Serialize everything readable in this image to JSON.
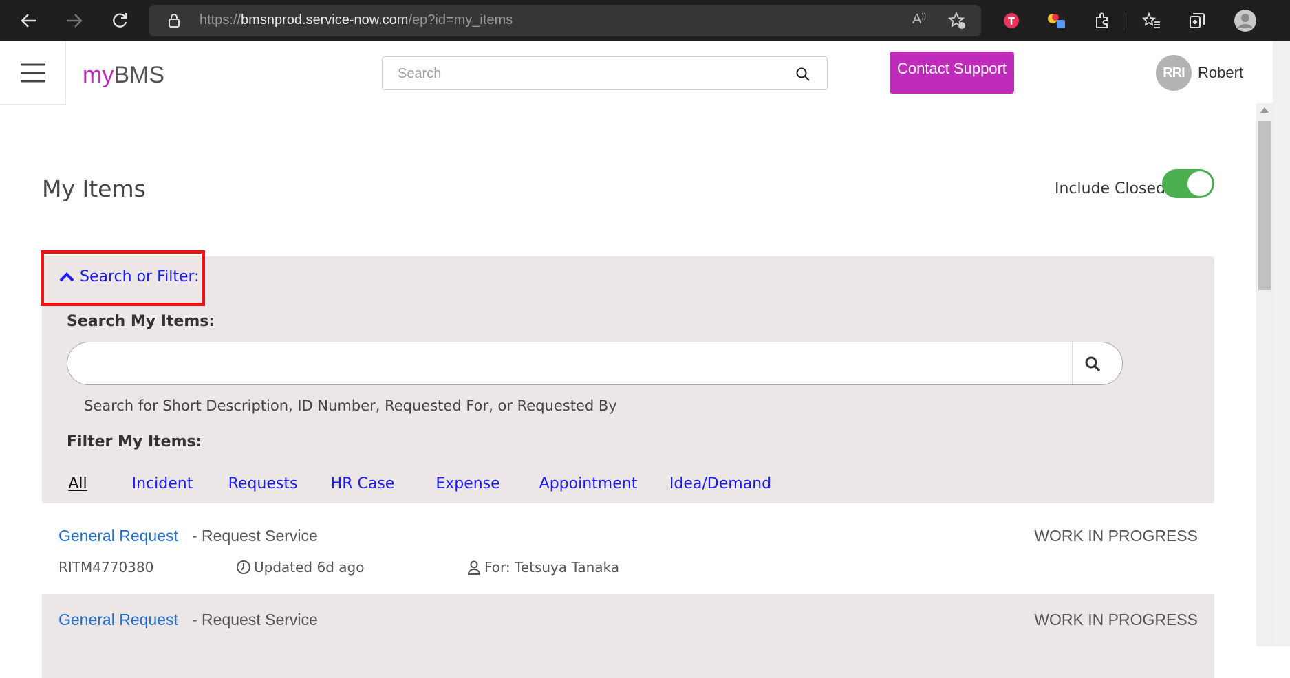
{
  "browser": {
    "url_prefix": "https://",
    "url_host": "bmsnprod.service-now.com",
    "url_path": "/ep?id=my_items"
  },
  "header": {
    "logo_my": "my",
    "logo_rest": "BMS",
    "search_placeholder": "Search",
    "contact_label": "Contact Support",
    "avatar_initials": "RRI",
    "user_name": "Robert"
  },
  "page": {
    "title": "My Items",
    "include_closed_label": "Include Closed",
    "include_closed_on": true
  },
  "filter": {
    "toggle_label": "Search or Filter:",
    "search_label": "Search My Items:",
    "search_value": "",
    "help_text": "Search for Short Description, ID Number, Requested For, or Requested By",
    "filter_label": "Filter My Items:",
    "tabs": [
      "All",
      "Incident",
      "Requests",
      "HR Case",
      "Expense",
      "Appointment",
      "Idea/Demand"
    ],
    "active_tab": "All"
  },
  "items": [
    {
      "link": "General Request",
      "type": "- Request Service",
      "status": "WORK IN PROGRESS",
      "number": "RITM4770380",
      "updated": "Updated 6d ago",
      "for": "For: Tetsuya Tanaka"
    },
    {
      "link": "General Request",
      "type": "- Request Service",
      "status": "WORK IN PROGRESS"
    }
  ],
  "colors": {
    "brand": "#be2bbb",
    "link": "#1f6fd0",
    "filter_link": "#1a1aff",
    "panel": "#ece6e6",
    "toggle_on": "#4caf50",
    "highlight": "#ee1111"
  }
}
